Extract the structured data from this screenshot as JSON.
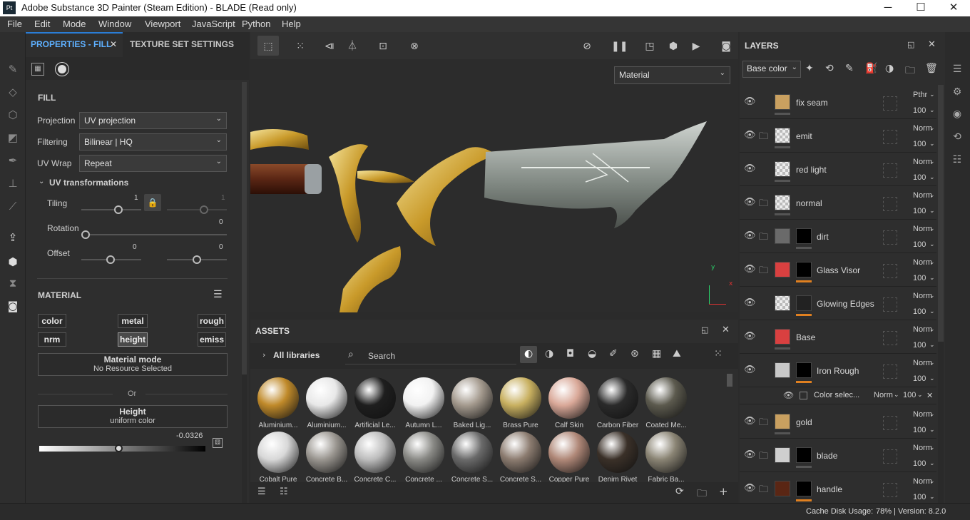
{
  "window": {
    "title": "Adobe Substance 3D Painter (Steam Edition) - BLADE (Read only)",
    "logo": "Pt",
    "minimize": "─",
    "maximize": "☐",
    "close": "✕"
  },
  "menu": [
    "File",
    "Edit",
    "Mode",
    "Window",
    "Viewport",
    "JavaScript",
    "Python",
    "Help"
  ],
  "props": {
    "tab_active": "PROPERTIES - FILL",
    "tab_close": "✕",
    "tab_other": "TEXTURE SET SETTINGS",
    "section_fill": "FILL",
    "projection_label": "Projection",
    "projection_value": "UV projection",
    "filtering_label": "Filtering",
    "filtering_value": "Bilinear | HQ",
    "uvwrap_label": "UV Wrap",
    "uvwrap_value": "Repeat",
    "uv_transformations": "UV transformations",
    "tiling_label": "Tiling",
    "tiling_value1": "1",
    "tiling_value2": "1",
    "rotation_label": "Rotation",
    "rotation_value": "0",
    "offset_label": "Offset",
    "offset_value1": "0",
    "offset_value2": "0",
    "section_material": "MATERIAL",
    "channels": [
      "color",
      "metal",
      "rough",
      "nrm",
      "height",
      "emiss"
    ],
    "material_mode_title": "Material mode",
    "material_mode_value": "No Resource Selected",
    "or": "Or",
    "height_title": "Height",
    "height_value": "uniform color",
    "height_number": "-0.0326"
  },
  "viewport": {
    "view_dropdown": "Material",
    "axis_x": "x",
    "axis_y": "y"
  },
  "assets": {
    "title": "ASSETS",
    "all_libraries": "All libraries",
    "search_placeholder": "Search",
    "row1": [
      "Aluminium...",
      "Aluminium...",
      "Artificial Le...",
      "Autumn L...",
      "Baked Lig...",
      "Brass Pure",
      "Calf Skin",
      "Carbon Fiber",
      "Coated Me..."
    ],
    "row2": [
      "Cobalt Pure",
      "Concrete B...",
      "Concrete C...",
      "Concrete ...",
      "Concrete S...",
      "Concrete S...",
      "Copper Pure",
      "Denim Rivet",
      "Fabric Ba..."
    ]
  },
  "layers": {
    "title": "LAYERS",
    "channel_dropdown": "Base color",
    "rows": [
      {
        "name": "fix seam",
        "blend": "Pthr",
        "opacity": "100"
      },
      {
        "name": "emit",
        "blend": "Norm",
        "opacity": "100"
      },
      {
        "name": "red light",
        "blend": "Norm",
        "opacity": "100"
      },
      {
        "name": "normal",
        "blend": "Norm",
        "opacity": "100"
      },
      {
        "name": "dirt",
        "blend": "Norm",
        "opacity": "100"
      },
      {
        "name": "Glass Visor",
        "blend": "Norm",
        "opacity": "100"
      },
      {
        "name": "Glowing Edges",
        "blend": "Norm",
        "opacity": "100"
      },
      {
        "name": "Base",
        "blend": "Norm",
        "opacity": "100"
      },
      {
        "name": "Iron Rough",
        "blend": "Norm",
        "opacity": "100"
      }
    ],
    "effect": {
      "name": "Color selec...",
      "blend": "Norm",
      "opacity": "100"
    },
    "rows2": [
      {
        "name": "gold",
        "blend": "Norm",
        "opacity": "100"
      },
      {
        "name": "blade",
        "blend": "Norm",
        "opacity": "100"
      },
      {
        "name": "handle",
        "blend": "Norm",
        "opacity": "100"
      }
    ]
  },
  "status": {
    "cache": "Cache Disk Usage:",
    "value": "78% | Version: 8.2.0"
  }
}
